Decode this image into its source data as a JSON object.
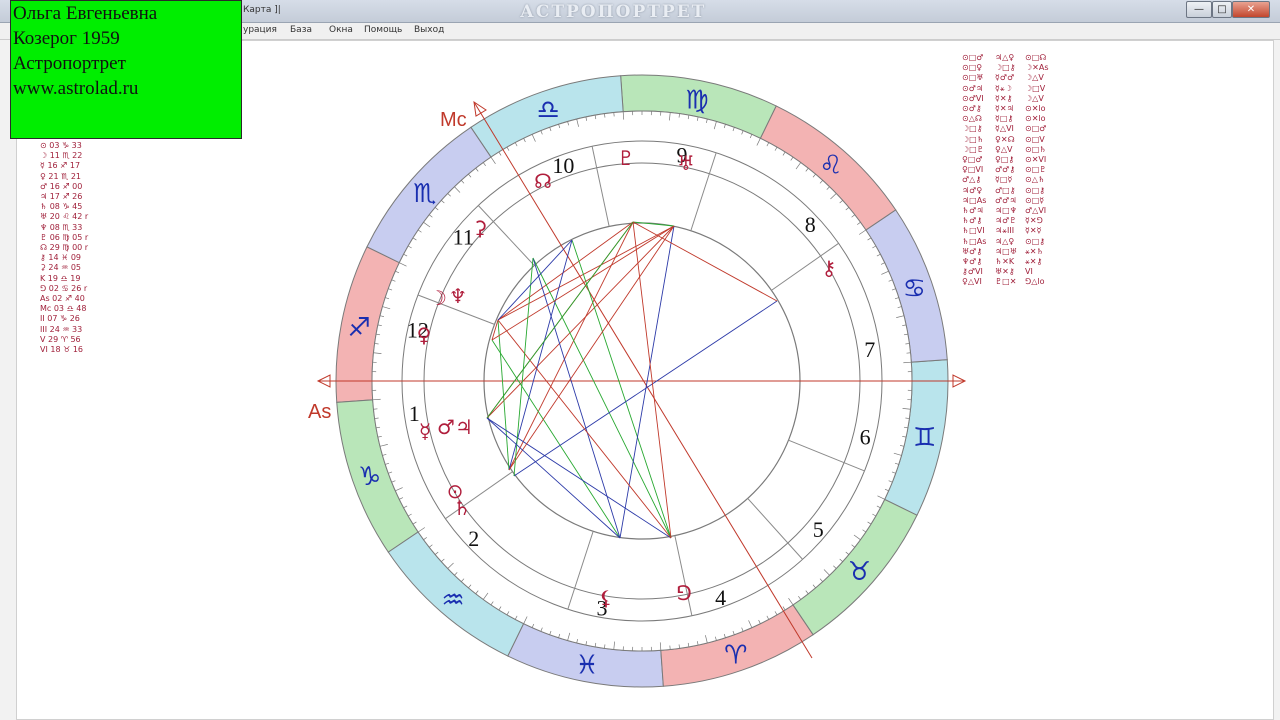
{
  "window": {
    "title": "АСТРОПОРТРЕТ",
    "doc_title": "Карта ]|",
    "buttons": {
      "minimize": "—",
      "maximize": "□",
      "close": "✕"
    }
  },
  "menu": [
    "урация",
    "База",
    "Окна",
    "Помощь",
    "Выход"
  ],
  "mdi_buttons": [
    "_",
    "□",
    "x"
  ],
  "overlay": {
    "line1": "Ольга Евгеньевна",
    "line2": "Козерог 1959",
    "line3": "Астропортрет",
    "line4": "www.astrolad.ru"
  },
  "positions": [
    "⊙ 03 ♑ 33",
    "☽ 11 ♏ 22",
    "☿ 16 ♐ 17",
    "♀ 21 ♏ 21",
    "♂ 16 ♐ 00",
    "♃ 17 ♐ 26",
    "♄ 08 ♑ 45",
    "♅ 20 ♌ 42 r",
    "♆ 08 ♏ 33",
    "♇ 06 ♍ 05 r",
    "☊ 29 ♍ 00 r",
    "⚷ 14 ♓ 09",
    "⚳ 24 ♒ 05",
    "K 19 ♎ 19",
    "⅁ 02 ♋ 26 r",
    "As 02 ♐ 40",
    "Mc 03 ♎ 48",
    "II 07 ♑ 26",
    "III 24 ♒ 33",
    "V 29 ♈ 56",
    "VI 18 ♉ 16"
  ],
  "aspects_col1": [
    "⊙□♂",
    "⊙□♀",
    "⊙□♅",
    "⊙♂♃",
    "⊙♂VI",
    "⊙♂⚷",
    "⊙△☊",
    "☽□⚷",
    "☽□♄",
    "☽□♇",
    "♀□♂",
    "♀□VI",
    "♂△⚷",
    "♃♂♀",
    "♃□As",
    "♄♂♃",
    "♄♂⚷",
    "♄□VI",
    "♄□As",
    "♅♂⚷",
    "♆♂⚷",
    "⚷♂VI",
    "♀△VI"
  ],
  "aspects_col2": [
    "♃△♀",
    "☽□⚷",
    "☿♂♂",
    "☿⚹☽",
    "☿✕⚷",
    "☿✕♃",
    "☿□⚷",
    "☿△VI",
    "♀✕☊",
    "♀△V",
    "♀□⚷",
    "♂♂⚷",
    "☿□☿",
    "♂□⚷",
    "♂♂♃",
    "♃□♆",
    "♃♂♇",
    "♃⚹III",
    "♃△♀",
    "♃□♅",
    "♄✕K",
    "♅✕⚷",
    "♇□✕"
  ],
  "aspects_col3": [
    "⊙□☊",
    "☽✕As",
    "☽△V",
    "☽□V",
    "☽△V",
    "⊙✕lo",
    "⊙✕lo",
    "⊙□♂",
    "⊙□V",
    "⊙□♄",
    "⊙✕VI",
    "⊙□♇",
    "⊙△♄",
    "⊙□⚷",
    "⊙□☿",
    "♂△VI",
    "☿✕⅁",
    "☿✕☿",
    "⊙□⚷",
    "⚹✕♄",
    "⚹✕⚷",
    "VI",
    "⅁△lo"
  ],
  "chart": {
    "angles": {
      "mc": "Mc",
      "as": "As"
    },
    "signs": [
      {
        "name": "sagittarius",
        "glyph": "♐",
        "color": "#f3b3b3"
      },
      {
        "name": "capricorn",
        "glyph": "♑",
        "color": "#b9e6b9"
      },
      {
        "name": "aquarius",
        "glyph": "♒",
        "color": "#b9e4ec"
      },
      {
        "name": "pisces",
        "glyph": "♓",
        "color": "#c8cdf0"
      },
      {
        "name": "aries",
        "glyph": "♈",
        "color": "#f3b3b3"
      },
      {
        "name": "taurus",
        "glyph": "♉",
        "color": "#b9e6b9"
      },
      {
        "name": "gemini",
        "glyph": "♊",
        "color": "#b9e4ec"
      },
      {
        "name": "cancer",
        "glyph": "♋",
        "color": "#c8cdf0"
      },
      {
        "name": "leo",
        "glyph": "♌",
        "color": "#f3b3b3"
      },
      {
        "name": "virgo",
        "glyph": "♍",
        "color": "#b9e6b9"
      },
      {
        "name": "libra",
        "glyph": "♎",
        "color": "#b9e4ec"
      },
      {
        "name": "scorpio",
        "glyph": "♏",
        "color": "#c8cdf0"
      }
    ],
    "houses": [
      "1",
      "2",
      "3",
      "4",
      "5",
      "6",
      "7",
      "8",
      "9",
      "10",
      "11",
      "12"
    ],
    "planets": [
      {
        "name": "moon",
        "glyph": "☽"
      },
      {
        "name": "neptune",
        "glyph": "♆"
      },
      {
        "name": "venus",
        "glyph": "♀"
      },
      {
        "name": "mercury",
        "glyph": "☿"
      },
      {
        "name": "mars",
        "glyph": "♂"
      },
      {
        "name": "jupiter",
        "glyph": "♃"
      },
      {
        "name": "sun",
        "glyph": "⊙"
      },
      {
        "name": "saturn",
        "glyph": "♄"
      },
      {
        "name": "node",
        "glyph": "☊"
      },
      {
        "name": "uranus",
        "glyph": "♅"
      },
      {
        "name": "pluto",
        "glyph": "♇"
      },
      {
        "name": "chiron",
        "glyph": "⚷"
      },
      {
        "name": "ceres",
        "glyph": "⚳"
      },
      {
        "name": "lilith",
        "glyph": "⚸"
      },
      {
        "name": "white-moon",
        "glyph": "⅁"
      }
    ],
    "accent_colors": {
      "red": "#c0392b",
      "blue": "#2c3aa8",
      "green": "#27a830",
      "glyph_red": "#b01e3c"
    }
  }
}
